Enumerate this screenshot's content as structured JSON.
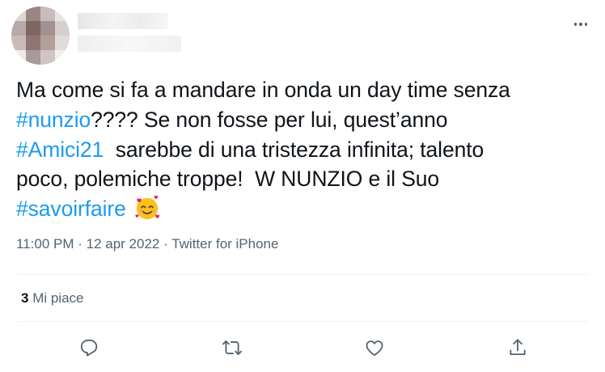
{
  "tweet": {
    "text_lines": [
      [
        {
          "text": "Ma come si fa a mandare in onda un day time senza"
        }
      ],
      [
        {
          "text": "#nunzio",
          "hashtag": true
        },
        {
          "text": "???? Se non fosse per lui, quest’anno"
        }
      ],
      [
        {
          "text": "#Amici21",
          "hashtag": true
        },
        {
          "text": "  sarebbe di una tristezza infinita; talento"
        }
      ],
      [
        {
          "text": "poco, polemiche troppe!  W NUNZIO e il Suo"
        }
      ],
      [
        {
          "text": "#savoirfaire",
          "hashtag": true
        },
        {
          "text": " "
        },
        {
          "emoji": "smiling-face-with-hearts"
        }
      ]
    ],
    "time": "11:00 PM",
    "date": "12 apr 2022",
    "separator": " · ",
    "source": "Twitter for iPhone",
    "likes_count": "3",
    "likes_label": " Mi piace"
  },
  "icons": {
    "more": "more-icon",
    "reply": "reply-icon",
    "retweet": "retweet-icon",
    "like": "heart-icon",
    "share": "share-icon"
  },
  "colors": {
    "hashtag": "#1d9bf0",
    "text": "#0f1419",
    "secondary": "#536471",
    "divider": "#eff3f4"
  }
}
